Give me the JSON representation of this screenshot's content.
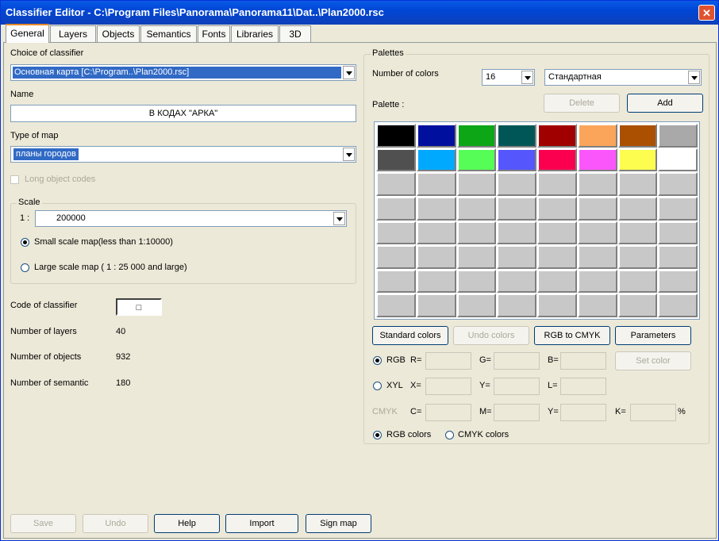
{
  "window": {
    "title": "Classifier Editor - C:\\Program Files\\Panorama\\Panorama11\\Dat..\\Plan2000.rsc",
    "close_label": "✕"
  },
  "tabs": [
    "General",
    "Layers",
    "Objects",
    "Semantics",
    "Fonts",
    "Libraries",
    "3D"
  ],
  "general": {
    "choice_label": "Choice of classifier",
    "choice_value": "Основная карта [C:\\Program..\\Plan2000.rsc]",
    "name_label": "Name",
    "name_value": "В КОДАХ \"АРКА\"",
    "type_label": "Type of map",
    "type_value": "планы городов",
    "long_codes_label": "Long object codes",
    "scale": {
      "label": "Scale",
      "prefix": "1 :",
      "value": "200000",
      "small_label": "Small scale map(less than 1:10000)",
      "large_label": "Large scale map ( 1 : 25 000 and large)"
    },
    "code_label": "Code of classifier",
    "code_value": "□",
    "layers_label": "Number of layers",
    "layers_value": "40",
    "objects_label": "Number of objects",
    "objects_value": "932",
    "semantic_label": "Number of semantic",
    "semantic_value": "180"
  },
  "palettes": {
    "label": "Palettes",
    "num_colors_label": "Number of colors",
    "num_colors_value": "16",
    "palette_name": "Стандартная",
    "palette_label": "Palette :",
    "delete_label": "Delete",
    "add_label": "Add",
    "colors": [
      "#000000",
      "#000f9e",
      "#0ca616",
      "#005656",
      "#a10000",
      "#fba55a",
      "#aa5000",
      "#a9a9a9",
      "#505050",
      "#00a9fd",
      "#56fd56",
      "#5656fd",
      "#fb004f",
      "#fb56fb",
      "#fdfd50",
      "#ffffff",
      "#c8c8c8",
      "#c8c8c8",
      "#c8c8c8",
      "#c8c8c8",
      "#c8c8c8",
      "#c8c8c8",
      "#c8c8c8",
      "#c8c8c8",
      "#c8c8c8",
      "#c8c8c8",
      "#c8c8c8",
      "#c8c8c8",
      "#c8c8c8",
      "#c8c8c8",
      "#c8c8c8",
      "#c8c8c8",
      "#c8c8c8",
      "#c8c8c8",
      "#c8c8c8",
      "#c8c8c8",
      "#c8c8c8",
      "#c8c8c8",
      "#c8c8c8",
      "#c8c8c8",
      "#c8c8c8",
      "#c8c8c8",
      "#c8c8c8",
      "#c8c8c8",
      "#c8c8c8",
      "#c8c8c8",
      "#c8c8c8",
      "#c8c8c8",
      "#c8c8c8",
      "#c8c8c8",
      "#c8c8c8",
      "#c8c8c8",
      "#c8c8c8",
      "#c8c8c8",
      "#c8c8c8",
      "#c8c8c8",
      "#c8c8c8",
      "#c8c8c8",
      "#c8c8c8",
      "#c8c8c8",
      "#c8c8c8",
      "#c8c8c8",
      "#c8c8c8",
      "#c8c8c8"
    ],
    "standard_colors_label": "Standard colors",
    "undo_colors_label": "Undo colors",
    "rgb_cmyk_label": "RGB  to CMYK",
    "parameters_label": "Parameters",
    "rgb_label": "RGB",
    "r_label": "R=",
    "g_label": "G=",
    "b_label": "B=",
    "set_color_label": "Set color",
    "xyl_label": "XYL",
    "x_label": "X=",
    "y_label": "Y=",
    "l_label": "L=",
    "cmyk_label": "CMYK",
    "c_label": "C=",
    "m_label": "M=",
    "y2_label": "Y=",
    "k_label": "K=",
    "percent": "%",
    "rgb_colors_label": "RGB colors",
    "cmyk_colors_label": "CMYK colors"
  },
  "footer": {
    "save": "Save",
    "undo": "Undo",
    "help": "Help",
    "import": "Import",
    "sign_map": "Sign map"
  }
}
